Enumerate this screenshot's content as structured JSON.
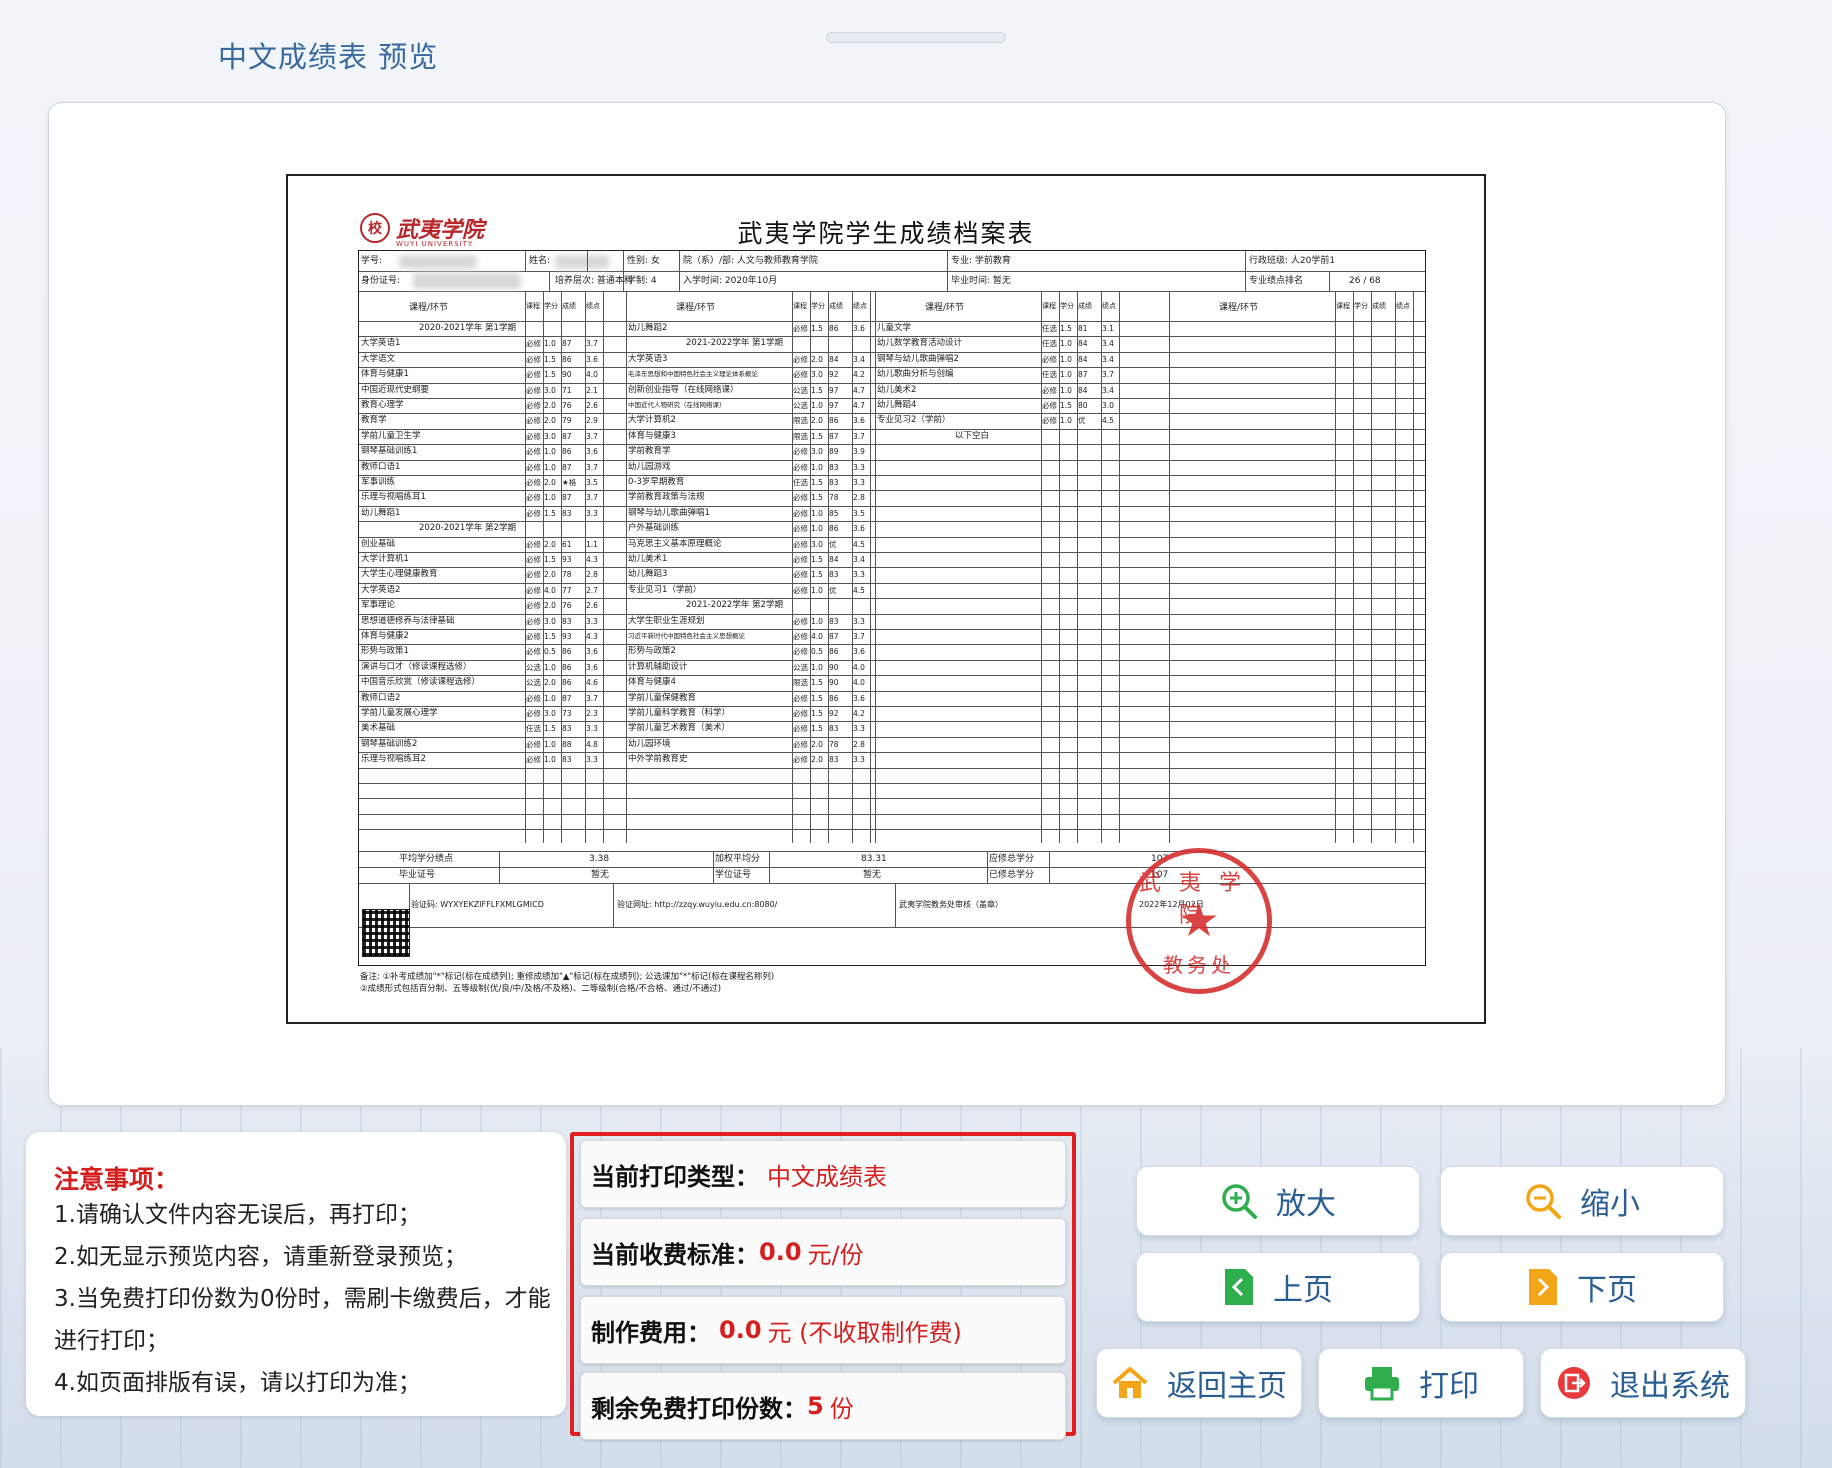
{
  "window": {
    "title": "中文成绩表 预览"
  },
  "document": {
    "logo_cn": "武夷学院",
    "logo_en": "WUYI UNIVERSITY",
    "title": "武夷学院学生成绩档案表",
    "header_row1": [
      "学号:",
      "姓名:",
      "性别: 女",
      "院（系）/部: 人文与教师教育学院",
      "专业: 学前教育",
      "行政班级: 人20学前1"
    ],
    "header_row2": [
      "身份证号:",
      "培养层次: 普通本科",
      "学制: 4",
      "入学时间: 2020年10月",
      "毕业时间: 暂无",
      "专业绩点排名",
      "26 / 68"
    ],
    "column_header": "课程/环节",
    "col_sub": [
      "课程性质",
      "学分",
      "成绩",
      "绩点"
    ],
    "block1": {
      "term": "2020-2021学年 第1学期",
      "rows": [
        [
          "大学英语1",
          "必修",
          "1.0",
          "87",
          "3.7"
        ],
        [
          "大学语文",
          "必修",
          "1.5",
          "86",
          "3.6"
        ],
        [
          "体育与健康1",
          "必修",
          "1.5",
          "90",
          "4.0"
        ],
        [
          "中国近现代史纲要",
          "必修",
          "3.0",
          "71",
          "2.1"
        ],
        [
          "教育心理学",
          "必修",
          "2.0",
          "76",
          "2.6"
        ],
        [
          "教育学",
          "必修",
          "2.0",
          "79",
          "2.9"
        ],
        [
          "学前儿童卫生学",
          "必修",
          "3.0",
          "87",
          "3.7"
        ],
        [
          "钢琴基础训练1",
          "必修",
          "1.0",
          "86",
          "3.6"
        ],
        [
          "教师口语1",
          "必修",
          "1.0",
          "87",
          "3.7"
        ],
        [
          "军事训练",
          "必修",
          "2.0",
          "★格",
          "3.5"
        ],
        [
          "乐理与视唱练耳1",
          "必修",
          "1.0",
          "87",
          "3.7"
        ],
        [
          "幼儿舞蹈1",
          "必修",
          "1.5",
          "83",
          "3.3"
        ]
      ],
      "term2": "2020-2021学年 第2学期",
      "rows2": [
        [
          "创业基础",
          "必修",
          "2.0",
          "61",
          "1.1"
        ],
        [
          "大学计算机1",
          "必修",
          "1.5",
          "93",
          "4.3"
        ],
        [
          "大学生心理健康教育",
          "必修",
          "2.0",
          "78",
          "2.8"
        ],
        [
          "大学英语2",
          "必修",
          "4.0",
          "77",
          "2.7"
        ],
        [
          "军事理论",
          "必修",
          "2.0",
          "76",
          "2.6"
        ],
        [
          "思想道德修养与法律基础",
          "必修",
          "3.0",
          "83",
          "3.3"
        ],
        [
          "体育与健康2",
          "必修",
          "1.5",
          "93",
          "4.3"
        ],
        [
          "形势与政策1",
          "必修",
          "0.5",
          "86",
          "3.6"
        ],
        [
          "演讲与口才（修读课程选修）",
          "公选",
          "1.0",
          "86",
          "3.6"
        ],
        [
          "中国音乐欣赏（修读课程选修）",
          "公选",
          "2.0",
          "86",
          "4.6"
        ],
        [
          "教师口语2",
          "必修",
          "1.0",
          "87",
          "3.7"
        ],
        [
          "学前儿童发展心理学",
          "必修",
          "3.0",
          "73",
          "2.3"
        ],
        [
          "美术基础",
          "任选",
          "1.5",
          "83",
          "3.3"
        ],
        [
          "钢琴基础训练2",
          "必修",
          "1.0",
          "88",
          "4.8"
        ],
        [
          "乐理与视唱练耳2",
          "必修",
          "1.0",
          "83",
          "3.3"
        ]
      ]
    },
    "block2": {
      "rows_a": [
        [
          "幼儿舞蹈2",
          "必修",
          "1.5",
          "86",
          "3.6"
        ]
      ],
      "term": "2021-2022学年 第1学期",
      "rows": [
        [
          "大学英语3",
          "必修",
          "2.0",
          "84",
          "3.4"
        ],
        [
          "毛泽东思想和中国特色社会主义理论体系概论",
          "必修",
          "3.0",
          "92",
          "4.2"
        ],
        [
          "创新创业指导（在线网络课）",
          "公选",
          "1.5",
          "97",
          "4.7"
        ],
        [
          "中国近代人物研究（在线网络课）",
          "公选",
          "1.0",
          "97",
          "4.7"
        ],
        [
          "大学计算机2",
          "限选",
          "2.0",
          "86",
          "3.6"
        ],
        [
          "体育与健康3",
          "限选",
          "1.5",
          "87",
          "3.7"
        ],
        [
          "学前教育学",
          "必修",
          "3.0",
          "89",
          "3.9"
        ],
        [
          "幼儿园游戏",
          "必修",
          "1.0",
          "83",
          "3.3"
        ],
        [
          "0-3岁早期教育",
          "任选",
          "1.5",
          "83",
          "3.3"
        ],
        [
          "学前教育政策与法规",
          "必修",
          "1.5",
          "78",
          "2.8"
        ],
        [
          "钢琴与幼儿歌曲弹唱1",
          "必修",
          "1.0",
          "85",
          "3.5"
        ],
        [
          "户外基础训练",
          "必修",
          "1.0",
          "86",
          "3.6"
        ],
        [
          "马克思主义基本原理概论",
          "必修",
          "3.0",
          "优",
          "4.5"
        ],
        [
          "幼儿美术1",
          "必修",
          "1.5",
          "84",
          "3.4"
        ],
        [
          "幼儿舞蹈3",
          "必修",
          "1.5",
          "83",
          "3.3"
        ],
        [
          "专业见习1（学前）",
          "必修",
          "1.0",
          "优",
          "4.5"
        ]
      ],
      "term2": "2021-2022学年 第2学期",
      "rows2": [
        [
          "大学生职业生涯规划",
          "必修",
          "1.0",
          "83",
          "3.3"
        ],
        [
          "习近平新时代中国特色社会主义思想概论",
          "必修",
          "4.0",
          "87",
          "3.7"
        ],
        [
          "形势与政策2",
          "必修",
          "0.5",
          "86",
          "3.6"
        ],
        [
          "计算机辅助设计",
          "公选",
          "1.0",
          "90",
          "4.0"
        ],
        [
          "体育与健康4",
          "限选",
          "1.5",
          "90",
          "4.0"
        ],
        [
          "学前儿童保健教育",
          "必修",
          "1.5",
          "86",
          "3.6"
        ],
        [
          "学前儿童科学教育（科学）",
          "必修",
          "1.5",
          "92",
          "4.2"
        ],
        [
          "学前儿童艺术教育（美术）",
          "必修",
          "1.5",
          "83",
          "3.3"
        ],
        [
          "幼儿园环境",
          "必修",
          "2.0",
          "78",
          "2.8"
        ],
        [
          "中外学前教育史",
          "必修",
          "2.0",
          "83",
          "3.3"
        ]
      ]
    },
    "block3": {
      "rows": [
        [
          "儿童文学",
          "任选",
          "1.5",
          "81",
          "3.1"
        ],
        [
          "幼儿数学教育活动设计",
          "任选",
          "1.0",
          "84",
          "3.4"
        ],
        [
          "钢琴与幼儿歌曲弹唱2",
          "必修",
          "1.0",
          "84",
          "3.4"
        ],
        [
          "幼儿歌曲分析与创编",
          "任选",
          "1.0",
          "87",
          "3.7"
        ],
        [
          "幼儿美术2",
          "必修",
          "1.0",
          "84",
          "3.4"
        ],
        [
          "幼儿舞蹈4",
          "必修",
          "1.5",
          "80",
          "3.0"
        ],
        [
          "专业见习2（学前）",
          "必修",
          "1.0",
          "优",
          "4.5"
        ]
      ],
      "end": "以下空白"
    },
    "summary": {
      "gpa_label": "平均学分绩点",
      "gpa": "3.38",
      "weighted_label": "加权平均分",
      "weighted": "83.31",
      "required_label": "应修总学分",
      "required": "107",
      "earned_label": "已修总学分",
      "earned": "107",
      "cert_label": "毕业证号",
      "cert": "暂无",
      "degree_label": "学位证号",
      "degree": "暂无"
    },
    "verify": {
      "code": "验证码: WYXYEKZIFFLFXMLGMICD",
      "url": "验证网址: http://zzqy.wuyiu.edu.cn:8080/",
      "office": "武夷学院教务处审核（盖章）",
      "date": "2022年12月02日"
    },
    "notes": [
      "备注: ①补考成绩加\"*\"标记(标在成绩列); 重修成绩加\"▲\"标记(标在成绩列); 公选课加\"*\"标记(标在课程名称列)",
      "②成绩形式包括百分制、五等级制(优/良/中/及格/不及格)、二等级制(合格/不合格、通过/不通过)"
    ],
    "stamp_top": "武夷学院",
    "stamp_bottom": "教务处"
  },
  "notice": {
    "heading": "注意事项：",
    "items": [
      "1.请确认文件内容无误后，再打印；",
      "2.如无显示预览内容，请重新登录预览；",
      "3.当免费打印份数为0份时，需刷卡缴费后，才能进行打印；",
      "4.如页面排版有误，请以打印为准；"
    ]
  },
  "fee": {
    "type_label": "当前打印类型：",
    "type_value": "中文成绩表",
    "std_label": "当前收费标准：",
    "std_num": "0.0",
    "std_unit": "元/份",
    "make_label": "制作费用：",
    "make_num": "0.0",
    "make_unit": "元 (不收取制作费)",
    "remain_label": "剩余免费打印份数：",
    "remain_num": "5",
    "remain_unit": "份"
  },
  "buttons": {
    "zoom_in": "放大",
    "zoom_out": "缩小",
    "prev": "上页",
    "next": "下页",
    "home": "返回主页",
    "print": "打印",
    "exit": "退出系统"
  },
  "colors": {
    "accent": "#2a5d92",
    "alert": "#d51f1f",
    "zoom_icon": "#2fae4e",
    "zoom_out_icon": "#f2a516",
    "home_icon": "#f2a516",
    "print_icon": "#2fae4e",
    "exit_icon": "#e8393d"
  }
}
